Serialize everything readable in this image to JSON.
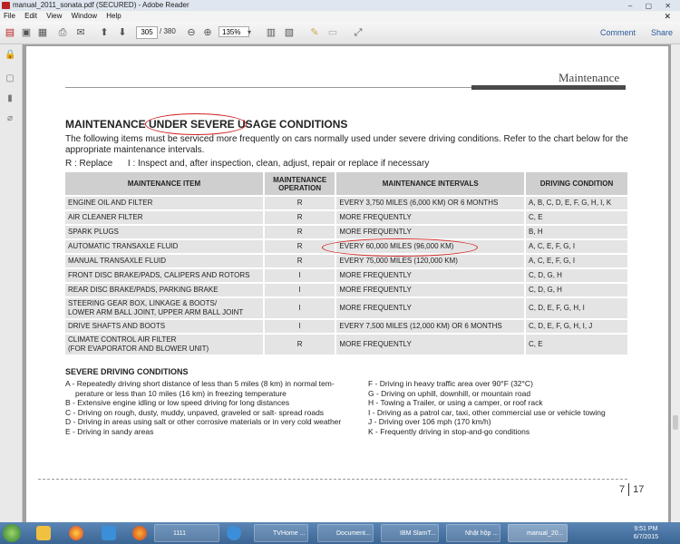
{
  "window": {
    "title": "manual_2011_sonata.pdf (SECURED) - Adobe Reader"
  },
  "menu": [
    "File",
    "Edit",
    "View",
    "Window",
    "Help"
  ],
  "toolbar": {
    "page": "305",
    "total": "/ 380",
    "zoom": "135%",
    "comment": "Comment",
    "share": "Share"
  },
  "doc": {
    "section": "Maintenance",
    "title": "MAINTENANCE UNDER SEVERE USAGE CONDITIONS",
    "intro": "The following items must be serviced more frequently on cars normally used under severe driving conditions. Refer to the chart below for the appropriate maintenance intervals.",
    "legend": "R : Replace      I : Inspect and, after inspection, clean, adjust, repair or replace if necessary",
    "table": {
      "headers": [
        "MAINTENANCE ITEM",
        "MAINTENANCE OPERATION",
        "MAINTENANCE INTERVALS",
        "DRIVING CONDITION"
      ],
      "rows": [
        [
          "ENGINE OIL AND FILTER",
          "R",
          "EVERY 3,750 MILES (6,000 KM) OR 6 MONTHS",
          "A, B, C, D, E, F, G, H, I, K"
        ],
        [
          "AIR CLEANER FILTER",
          "R",
          "MORE FREQUENTLY",
          "C, E"
        ],
        [
          "SPARK PLUGS",
          "R",
          "MORE FREQUENTLY",
          "B, H"
        ],
        [
          "AUTOMATIC TRANSAXLE FLUID",
          "R",
          "EVERY 60,000 MILES (96,000 KM)",
          "A, C, E, F, G, I"
        ],
        [
          "MANUAL TRANSAXLE FLUID",
          "R",
          "EVERY 75,000 MILES (120,000 KM)",
          "A, C, E, F, G, I"
        ],
        [
          "FRONT DISC BRAKE/PADS, CALIPERS AND ROTORS",
          "I",
          "MORE FREQUENTLY",
          "C, D, G, H"
        ],
        [
          "REAR DISC BRAKE/PADS, PARKING BRAKE",
          "I",
          "MORE FREQUENTLY",
          "C, D, G, H"
        ],
        [
          "STEERING GEAR BOX, LINKAGE & BOOTS/\nLOWER ARM BALL JOINT, UPPER ARM BALL JOINT",
          "I",
          "MORE FREQUENTLY",
          "C, D, E, F, G, H, I"
        ],
        [
          "DRIVE SHAFTS AND BOOTS",
          "I",
          "EVERY 7,500 MILES (12,000 KM) OR 6 MONTHS",
          "C, D, E, F, G, H, I, J"
        ],
        [
          "CLIMATE CONTROL AIR FILTER\n(FOR EVAPORATOR AND BLOWER UNIT)",
          "R",
          "MORE FREQUENTLY",
          "C, E"
        ]
      ]
    },
    "severe_title": "SEVERE DRIVING CONDITIONS",
    "conditions_left": [
      "A - Repeatedly driving short distance of less than 5 miles (8 km) in normal tem-",
      "perature or less than 10 miles (16 km) in freezing temperature",
      "B - Extensive engine idling or low speed driving for long distances",
      "C - Driving on rough, dusty, muddy, unpaved, graveled or salt- spread roads",
      "D - Driving in areas using salt or other corrosive materials or in very cold weather",
      "E - Driving in sandy areas"
    ],
    "conditions_right": [
      "F - Driving in heavy traffic area over 90°F (32°C)",
      "G - Driving on uphill, downhill, or mountain road",
      "H - Towing a Trailer, or using a camper, or roof rack",
      "I  - Driving as a patrol car, taxi, other commercial use or vehicle towing",
      "J  - Driving over 106 mph (170 km/h)",
      "K - Frequently driving in stop-and-go conditions"
    ],
    "page_chapter": "7",
    "page_num": "17"
  },
  "taskbar": {
    "buttons": [
      "1111",
      "TVHome ...",
      "Document...",
      "IBM SlamT...",
      "Nhật hộp ...",
      "manual_20..."
    ],
    "time": "9:51 PM",
    "date": "6/7/2015"
  }
}
